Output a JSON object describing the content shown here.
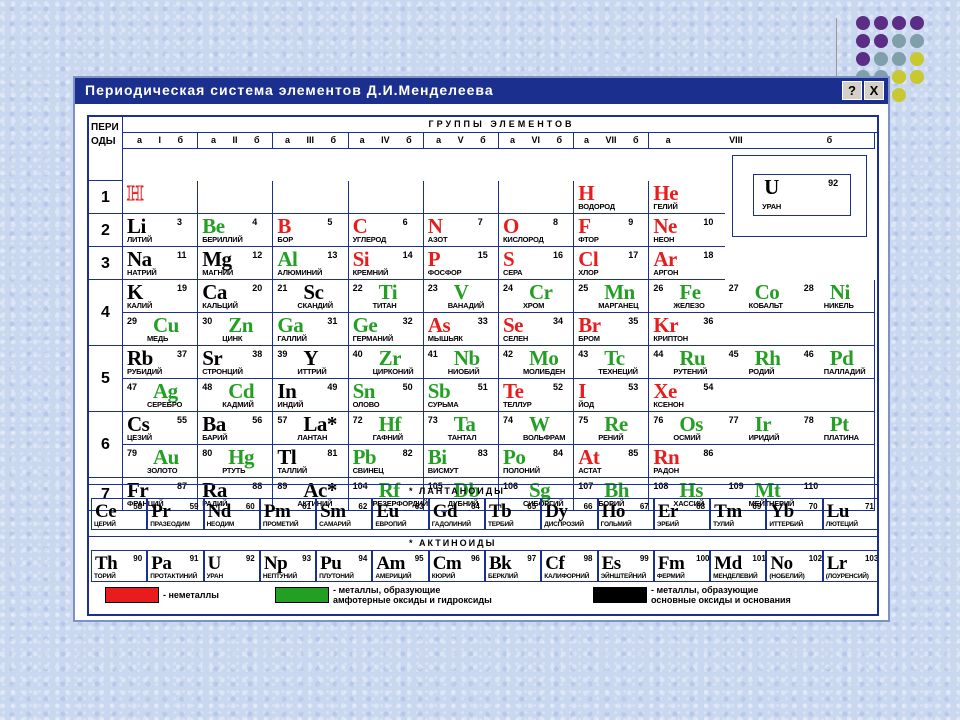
{
  "colors": {
    "nonmetal": "#e81c1c",
    "amphoteric": "#23a023",
    "basic": "#000000"
  },
  "window": {
    "title": "Периодическая система элементов Д.И.Менделеева",
    "help_label": "?",
    "close_label": "X"
  },
  "table": {
    "period_header": "ПЕРИ\nОДЫ",
    "groups_header": "ГРУППЫ ЭЛЕМЕНТОВ",
    "subgroups": [
      "а I б",
      "а II б",
      "а III б",
      "а IV б",
      "а V б",
      "а VI б",
      "а VII б",
      "а",
      "VIII",
      "б"
    ],
    "periods": [
      "1",
      "2",
      "3",
      "4",
      "5",
      "6",
      "7"
    ],
    "lanthanides_label": "ЛАНТАНОИДЫ",
    "actinides_label": "АКТИНОИДЫ",
    "legend": [
      {
        "text": "- неметаллы",
        "kind": "nonmetal"
      },
      {
        "text": "- металлы, образующие\nамфотерные оксиды и гидроксиды",
        "kind": "amphoteric"
      },
      {
        "text": "- металлы, образующие\nосновные оксиды и основания",
        "kind": "basic"
      }
    ],
    "sample": {
      "sym": "U",
      "num": "92",
      "name": "УРАН"
    },
    "elements": [
      {
        "r": 0,
        "c": 0,
        "sym": "H",
        "num": "",
        "name": "",
        "side": "a",
        "kind": "nonmetal",
        "outline": true
      },
      {
        "r": 0,
        "c": 6,
        "sym": "H",
        "num": "",
        "name": "ВОДОРОД",
        "side": "a",
        "kind": "nonmetal"
      },
      {
        "r": 0,
        "c": 7,
        "sym": "He",
        "num": "",
        "name": "ГЕЛИЙ",
        "side": "a",
        "kind": "nonmetal"
      },
      {
        "r": 1,
        "c": 0,
        "sym": "Li",
        "num": "3",
        "name": "ЛИТИЙ",
        "side": "a",
        "kind": "basic"
      },
      {
        "r": 1,
        "c": 1,
        "sym": "Be",
        "num": "4",
        "name": "БЕРИЛЛИЙ",
        "side": "a",
        "kind": "amphoteric"
      },
      {
        "r": 1,
        "c": 2,
        "sym": "B",
        "num": "5",
        "name": "БОР",
        "side": "a",
        "kind": "nonmetal"
      },
      {
        "r": 1,
        "c": 3,
        "sym": "C",
        "num": "6",
        "name": "УГЛЕРОД",
        "side": "a",
        "kind": "nonmetal"
      },
      {
        "r": 1,
        "c": 4,
        "sym": "N",
        "num": "7",
        "name": "АЗОТ",
        "side": "a",
        "kind": "nonmetal"
      },
      {
        "r": 1,
        "c": 5,
        "sym": "O",
        "num": "8",
        "name": "КИСЛОРОД",
        "side": "a",
        "kind": "nonmetal"
      },
      {
        "r": 1,
        "c": 6,
        "sym": "F",
        "num": "9",
        "name": "ФТОР",
        "side": "a",
        "kind": "nonmetal"
      },
      {
        "r": 1,
        "c": 7,
        "sym": "Ne",
        "num": "10",
        "name": "НЕОН",
        "side": "a",
        "kind": "nonmetal"
      },
      {
        "r": 2,
        "c": 0,
        "sym": "Na",
        "num": "11",
        "name": "НАТРИЙ",
        "side": "a",
        "kind": "basic"
      },
      {
        "r": 2,
        "c": 1,
        "sym": "Mg",
        "num": "12",
        "name": "МАГНИЙ",
        "side": "a",
        "kind": "basic"
      },
      {
        "r": 2,
        "c": 2,
        "sym": "Al",
        "num": "13",
        "name": "АЛЮМИНИЙ",
        "side": "a",
        "kind": "amphoteric"
      },
      {
        "r": 2,
        "c": 3,
        "sym": "Si",
        "num": "14",
        "name": "КРЕМНИЙ",
        "side": "a",
        "kind": "nonmetal"
      },
      {
        "r": 2,
        "c": 4,
        "sym": "P",
        "num": "15",
        "name": "ФОСФОР",
        "side": "a",
        "kind": "nonmetal"
      },
      {
        "r": 2,
        "c": 5,
        "sym": "S",
        "num": "16",
        "name": "СЕРА",
        "side": "a",
        "kind": "nonmetal"
      },
      {
        "r": 2,
        "c": 6,
        "sym": "Cl",
        "num": "17",
        "name": "ХЛОР",
        "side": "a",
        "kind": "nonmetal"
      },
      {
        "r": 2,
        "c": 7,
        "sym": "Ar",
        "num": "18",
        "name": "АРГОН",
        "side": "a",
        "kind": "nonmetal"
      },
      {
        "r": 3,
        "c": 0,
        "sym": "K",
        "num": "19",
        "name": "КАЛИЙ",
        "side": "a",
        "kind": "basic"
      },
      {
        "r": 3,
        "c": 1,
        "sym": "Ca",
        "num": "20",
        "name": "КАЛЬЦИЙ",
        "side": "a",
        "kind": "basic"
      },
      {
        "r": 3,
        "c": 2,
        "sym": "Sc",
        "num": "21",
        "name": "СКАНДИЙ",
        "side": "b",
        "kind": "basic"
      },
      {
        "r": 3,
        "c": 3,
        "sym": "Ti",
        "num": "22",
        "name": "ТИТАН",
        "side": "b",
        "kind": "amphoteric"
      },
      {
        "r": 3,
        "c": 4,
        "sym": "V",
        "num": "23",
        "name": "ВАНАДИЙ",
        "side": "b",
        "kind": "amphoteric"
      },
      {
        "r": 3,
        "c": 5,
        "sym": "Cr",
        "num": "24",
        "name": "ХРОМ",
        "side": "b",
        "kind": "amphoteric"
      },
      {
        "r": 3,
        "c": 6,
        "sym": "Mn",
        "num": "25",
        "name": "МАРГАНЕЦ",
        "side": "b",
        "kind": "amphoteric"
      },
      {
        "r": 3,
        "c": 7,
        "sym": "Fe",
        "num": "26",
        "name": "ЖЕЛЕЗО",
        "side": "b",
        "kind": "amphoteric"
      },
      {
        "r": 3,
        "c": 8,
        "sym": "Co",
        "num": "27",
        "name": "КОБАЛЬТ",
        "side": "b",
        "kind": "amphoteric"
      },
      {
        "r": 3,
        "c": 9,
        "sym": "Ni",
        "num": "28",
        "name": "НИКЕЛЬ",
        "side": "b",
        "kind": "amphoteric"
      },
      {
        "r": 4,
        "c": 0,
        "sym": "Cu",
        "num": "29",
        "name": "МЕДЬ",
        "side": "b",
        "kind": "amphoteric"
      },
      {
        "r": 4,
        "c": 1,
        "sym": "Zn",
        "num": "30",
        "name": "ЦИНК",
        "side": "b",
        "kind": "amphoteric"
      },
      {
        "r": 4,
        "c": 2,
        "sym": "Ga",
        "num": "31",
        "name": "ГАЛЛИЙ",
        "side": "a",
        "kind": "amphoteric"
      },
      {
        "r": 4,
        "c": 3,
        "sym": "Ge",
        "num": "32",
        "name": "ГЕРМАНИЙ",
        "side": "a",
        "kind": "amphoteric"
      },
      {
        "r": 4,
        "c": 4,
        "sym": "As",
        "num": "33",
        "name": "МЫШЬЯК",
        "side": "a",
        "kind": "nonmetal"
      },
      {
        "r": 4,
        "c": 5,
        "sym": "Se",
        "num": "34",
        "name": "СЕЛЕН",
        "side": "a",
        "kind": "nonmetal"
      },
      {
        "r": 4,
        "c": 6,
        "sym": "Br",
        "num": "35",
        "name": "БРОМ",
        "side": "a",
        "kind": "nonmetal"
      },
      {
        "r": 4,
        "c": 7,
        "sym": "Kr",
        "num": "36",
        "name": "КРИПТОН",
        "side": "a",
        "kind": "nonmetal"
      },
      {
        "r": 5,
        "c": 0,
        "sym": "Rb",
        "num": "37",
        "name": "РУБИДИЙ",
        "side": "a",
        "kind": "basic"
      },
      {
        "r": 5,
        "c": 1,
        "sym": "Sr",
        "num": "38",
        "name": "СТРОНЦИЙ",
        "side": "a",
        "kind": "basic"
      },
      {
        "r": 5,
        "c": 2,
        "sym": "Y",
        "num": "39",
        "name": "ИТТРИЙ",
        "side": "b",
        "kind": "basic"
      },
      {
        "r": 5,
        "c": 3,
        "sym": "Zr",
        "num": "40",
        "name": "ЦИРКОНИЙ",
        "side": "b",
        "kind": "amphoteric"
      },
      {
        "r": 5,
        "c": 4,
        "sym": "Nb",
        "num": "41",
        "name": "НИОБИЙ",
        "side": "b",
        "kind": "amphoteric"
      },
      {
        "r": 5,
        "c": 5,
        "sym": "Mo",
        "num": "42",
        "name": "МОЛИБДЕН",
        "side": "b",
        "kind": "amphoteric"
      },
      {
        "r": 5,
        "c": 6,
        "sym": "Tc",
        "num": "43",
        "name": "ТЕХНЕЦИЙ",
        "side": "b",
        "kind": "amphoteric"
      },
      {
        "r": 5,
        "c": 7,
        "sym": "Ru",
        "num": "44",
        "name": "РУТЕНИЙ",
        "side": "b",
        "kind": "amphoteric"
      },
      {
        "r": 5,
        "c": 8,
        "sym": "Rh",
        "num": "45",
        "name": "РОДИЙ",
        "side": "b",
        "kind": "amphoteric"
      },
      {
        "r": 5,
        "c": 9,
        "sym": "Pd",
        "num": "46",
        "name": "ПАЛЛАДИЙ",
        "side": "b",
        "kind": "amphoteric"
      },
      {
        "r": 6,
        "c": 0,
        "sym": "Ag",
        "num": "47",
        "name": "СЕРЕБРО",
        "side": "b",
        "kind": "amphoteric"
      },
      {
        "r": 6,
        "c": 1,
        "sym": "Cd",
        "num": "48",
        "name": "КАДМИЙ",
        "side": "b",
        "kind": "amphoteric"
      },
      {
        "r": 6,
        "c": 2,
        "sym": "In",
        "num": "49",
        "name": "ИНДИЙ",
        "side": "a",
        "kind": "basic"
      },
      {
        "r": 6,
        "c": 3,
        "sym": "Sn",
        "num": "50",
        "name": "ОЛОВО",
        "side": "a",
        "kind": "amphoteric"
      },
      {
        "r": 6,
        "c": 4,
        "sym": "Sb",
        "num": "51",
        "name": "СУРЬМА",
        "side": "a",
        "kind": "amphoteric"
      },
      {
        "r": 6,
        "c": 5,
        "sym": "Te",
        "num": "52",
        "name": "ТЕЛЛУР",
        "side": "a",
        "kind": "nonmetal"
      },
      {
        "r": 6,
        "c": 6,
        "sym": "I",
        "num": "53",
        "name": "ЙОД",
        "side": "a",
        "kind": "nonmetal"
      },
      {
        "r": 6,
        "c": 7,
        "sym": "Xe",
        "num": "54",
        "name": "КСЕНОН",
        "side": "a",
        "kind": "nonmetal"
      },
      {
        "r": 7,
        "c": 0,
        "sym": "Cs",
        "num": "55",
        "name": "ЦЕЗИЙ",
        "side": "a",
        "kind": "basic"
      },
      {
        "r": 7,
        "c": 1,
        "sym": "Ba",
        "num": "56",
        "name": "БАРИЙ",
        "side": "a",
        "kind": "basic"
      },
      {
        "r": 7,
        "c": 2,
        "sym": "La*",
        "num": "57",
        "name": "ЛАНТАН",
        "side": "b",
        "kind": "basic"
      },
      {
        "r": 7,
        "c": 3,
        "sym": "Hf",
        "num": "72",
        "name": "ГАФНИЙ",
        "side": "b",
        "kind": "amphoteric"
      },
      {
        "r": 7,
        "c": 4,
        "sym": "Ta",
        "num": "73",
        "name": "ТАНТАЛ",
        "side": "b",
        "kind": "amphoteric"
      },
      {
        "r": 7,
        "c": 5,
        "sym": "W",
        "num": "74",
        "name": "ВОЛЬФРАМ",
        "side": "b",
        "kind": "amphoteric"
      },
      {
        "r": 7,
        "c": 6,
        "sym": "Re",
        "num": "75",
        "name": "РЕНИЙ",
        "side": "b",
        "kind": "amphoteric"
      },
      {
        "r": 7,
        "c": 7,
        "sym": "Os",
        "num": "76",
        "name": "ОСМИЙ",
        "side": "b",
        "kind": "amphoteric"
      },
      {
        "r": 7,
        "c": 8,
        "sym": "Ir",
        "num": "77",
        "name": "ИРИДИЙ",
        "side": "b",
        "kind": "amphoteric"
      },
      {
        "r": 7,
        "c": 9,
        "sym": "Pt",
        "num": "78",
        "name": "ПЛАТИНА",
        "side": "b",
        "kind": "amphoteric"
      },
      {
        "r": 8,
        "c": 0,
        "sym": "Au",
        "num": "79",
        "name": "ЗОЛОТО",
        "side": "b",
        "kind": "amphoteric"
      },
      {
        "r": 8,
        "c": 1,
        "sym": "Hg",
        "num": "80",
        "name": "РТУТЬ",
        "side": "b",
        "kind": "amphoteric"
      },
      {
        "r": 8,
        "c": 2,
        "sym": "Tl",
        "num": "81",
        "name": "ТАЛЛИЙ",
        "side": "a",
        "kind": "basic"
      },
      {
        "r": 8,
        "c": 3,
        "sym": "Pb",
        "num": "82",
        "name": "СВИНЕЦ",
        "side": "a",
        "kind": "amphoteric"
      },
      {
        "r": 8,
        "c": 4,
        "sym": "Bi",
        "num": "83",
        "name": "ВИСМУТ",
        "side": "a",
        "kind": "amphoteric"
      },
      {
        "r": 8,
        "c": 5,
        "sym": "Po",
        "num": "84",
        "name": "ПОЛОНИЙ",
        "side": "a",
        "kind": "amphoteric"
      },
      {
        "r": 8,
        "c": 6,
        "sym": "At",
        "num": "85",
        "name": "АСТАТ",
        "side": "a",
        "kind": "nonmetal"
      },
      {
        "r": 8,
        "c": 7,
        "sym": "Rn",
        "num": "86",
        "name": "РАДОН",
        "side": "a",
        "kind": "nonmetal"
      },
      {
        "r": 9,
        "c": 0,
        "sym": "Fr",
        "num": "87",
        "name": "ФРАНЦИЙ",
        "side": "a",
        "kind": "basic"
      },
      {
        "r": 9,
        "c": 1,
        "sym": "Ra",
        "num": "88",
        "name": "РАДИЙ",
        "side": "a",
        "kind": "basic"
      },
      {
        "r": 9,
        "c": 2,
        "sym": "Ac*",
        "num": "89",
        "name": "АКТИНИЙ",
        "side": "b",
        "kind": "basic"
      },
      {
        "r": 9,
        "c": 3,
        "sym": "Rf",
        "num": "104",
        "name": "РЕЗЕРФОРДИЙ",
        "side": "b",
        "kind": "amphoteric"
      },
      {
        "r": 9,
        "c": 4,
        "sym": "Db",
        "num": "105",
        "name": "ДУБНИЙ",
        "side": "b",
        "kind": "amphoteric"
      },
      {
        "r": 9,
        "c": 5,
        "sym": "Sg",
        "num": "106",
        "name": "СИБОРГИЙ",
        "side": "b",
        "kind": "amphoteric"
      },
      {
        "r": 9,
        "c": 6,
        "sym": "Bh",
        "num": "107",
        "name": "БОРИЙ",
        "side": "b",
        "kind": "amphoteric"
      },
      {
        "r": 9,
        "c": 7,
        "sym": "Hs",
        "num": "108",
        "name": "ХАССИЙ",
        "side": "b",
        "kind": "amphoteric"
      },
      {
        "r": 9,
        "c": 8,
        "sym": "Mt",
        "num": "109",
        "name": "МЕЙТНЕРИЙ",
        "side": "b",
        "kind": "amphoteric"
      },
      {
        "r": 9,
        "c": 9,
        "sym": "",
        "num": "110",
        "name": "",
        "side": "b",
        "kind": "amphoteric"
      }
    ],
    "lanthanides": [
      {
        "sym": "Ce",
        "num": "58",
        "name": "ЦЕРИЙ"
      },
      {
        "sym": "Pr",
        "num": "59",
        "name": "ПРАЗЕОДИМ"
      },
      {
        "sym": "Nd",
        "num": "60",
        "name": "НЕОДИМ"
      },
      {
        "sym": "Pm",
        "num": "61",
        "name": "ПРОМЕТИЙ"
      },
      {
        "sym": "Sm",
        "num": "62",
        "name": "САМАРИЙ"
      },
      {
        "sym": "Eu",
        "num": "63",
        "name": "ЕВРОПИЙ"
      },
      {
        "sym": "Gd",
        "num": "64",
        "name": "ГАДОЛИНИЙ"
      },
      {
        "sym": "Tb",
        "num": "65",
        "name": "ТЕРБИЙ"
      },
      {
        "sym": "Dy",
        "num": "66",
        "name": "ДИСПРОЗИЙ"
      },
      {
        "sym": "Ho",
        "num": "67",
        "name": "ГОЛЬМИЙ"
      },
      {
        "sym": "Er",
        "num": "68",
        "name": "ЭРБИЙ"
      },
      {
        "sym": "Tm",
        "num": "69",
        "name": "ТУЛИЙ"
      },
      {
        "sym": "Yb",
        "num": "70",
        "name": "ИТТЕРБИЙ"
      },
      {
        "sym": "Lu",
        "num": "71",
        "name": "ЛЮТЕЦИЙ"
      }
    ],
    "actinides": [
      {
        "sym": "Th",
        "num": "90",
        "name": "ТОРИЙ"
      },
      {
        "sym": "Pa",
        "num": "91",
        "name": "ПРОТАКТИНИЙ"
      },
      {
        "sym": "U",
        "num": "92",
        "name": "УРАН"
      },
      {
        "sym": "Np",
        "num": "93",
        "name": "НЕПТУНИЙ"
      },
      {
        "sym": "Pu",
        "num": "94",
        "name": "ПЛУТОНИЙ"
      },
      {
        "sym": "Am",
        "num": "95",
        "name": "АМЕРИЦИЙ"
      },
      {
        "sym": "Cm",
        "num": "96",
        "name": "КЮРИЙ"
      },
      {
        "sym": "Bk",
        "num": "97",
        "name": "БЕРКЛИЙ"
      },
      {
        "sym": "Cf",
        "num": "98",
        "name": "КАЛИФОРНИЙ"
      },
      {
        "sym": "Es",
        "num": "99",
        "name": "ЭЙНШТЕЙНИЙ"
      },
      {
        "sym": "Fm",
        "num": "100",
        "name": "ФЕРМИЙ"
      },
      {
        "sym": "Md",
        "num": "101",
        "name": "МЕНДЕЛЕВИЙ"
      },
      {
        "sym": "No",
        "num": "102",
        "name": "(НОБЕЛИЙ)"
      },
      {
        "sym": "Lr",
        "num": "103",
        "name": "(ЛОУРЕНСИЙ)"
      }
    ]
  }
}
